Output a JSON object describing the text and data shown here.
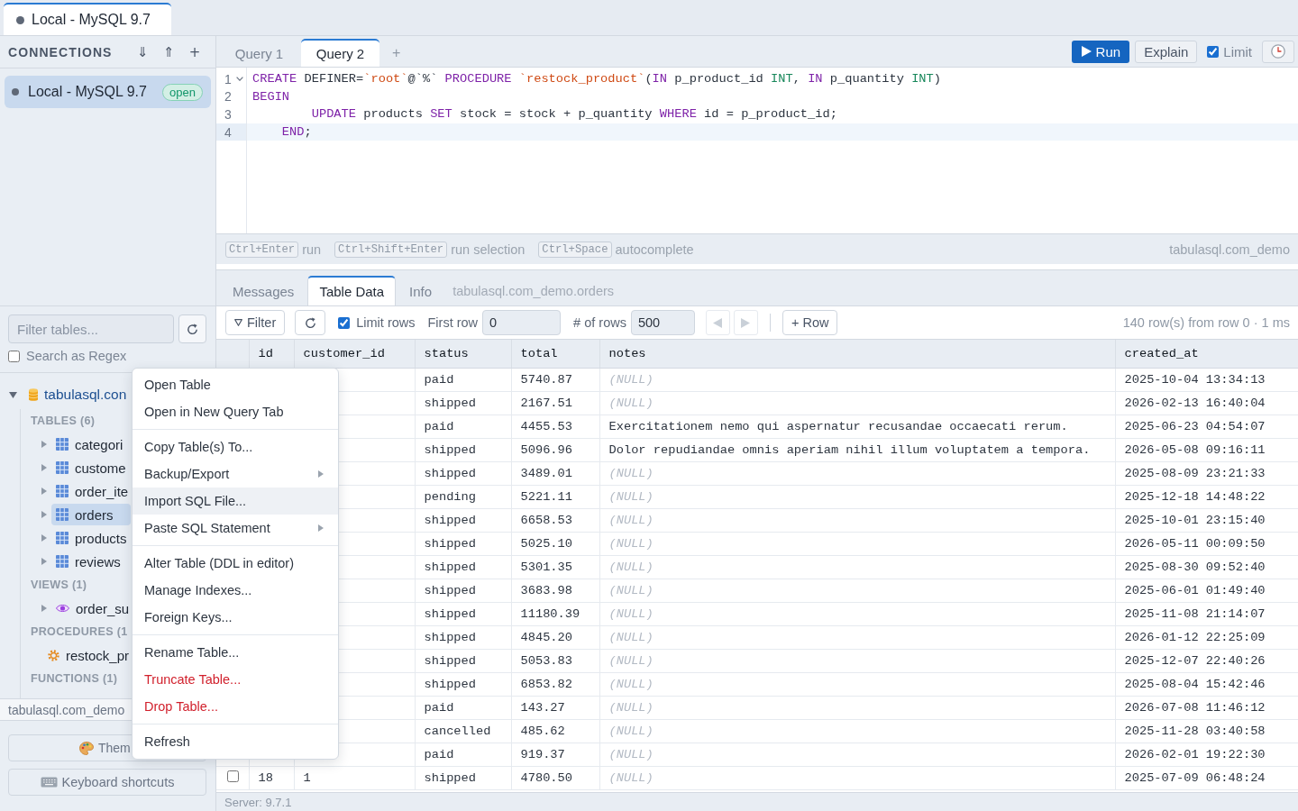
{
  "window_tabs": [
    {
      "label": "Local - MySQL 9.7",
      "selected": true
    }
  ],
  "sidebar": {
    "title": "CONNECTIONS",
    "actions": [
      "⇓",
      "⇑",
      "+"
    ],
    "connections": [
      {
        "name": "Local - MySQL 9.7",
        "badge": "open",
        "selected": true
      }
    ],
    "filter": {
      "placeholder": "Filter tables..."
    },
    "regex": {
      "label": "Search as Regex",
      "checked": false
    },
    "tree": {
      "name": "tabulasql.con",
      "expanded": true,
      "children": [
        {
          "kind": "section",
          "label": "TABLES (6)",
          "children": [
            {
              "kind": "table",
              "name": "categori",
              "expanded": false,
              "selected": false
            },
            {
              "kind": "table",
              "name": "custome",
              "expanded": false,
              "selected": false
            },
            {
              "kind": "table",
              "name": "order_ite",
              "expanded": false,
              "selected": false
            },
            {
              "kind": "table",
              "name": "orders",
              "expanded": false,
              "selected": true
            },
            {
              "kind": "table",
              "name": "products",
              "expanded": false,
              "selected": false
            },
            {
              "kind": "table",
              "name": "reviews",
              "expanded": false,
              "selected": false
            }
          ]
        },
        {
          "kind": "section",
          "label": "VIEWS (1)",
          "children": [
            {
              "kind": "view",
              "name": "order_su",
              "expanded": false,
              "selected": false
            }
          ]
        },
        {
          "kind": "section",
          "label": "PROCEDURES (1",
          "children": [
            {
              "kind": "procedure",
              "name": "restock_pr",
              "selected": false
            }
          ]
        },
        {
          "kind": "section",
          "label": "FUNCTIONS (1)"
        }
      ]
    },
    "database": "tabulasql.com_demo",
    "buttons": [
      {
        "kind": "theme",
        "label": "Them"
      },
      {
        "kind": "shortcuts",
        "label": "Keyboard shortcuts"
      }
    ]
  },
  "editor": {
    "tabs": [
      {
        "label": "Query 1",
        "selected": false
      },
      {
        "label": "Query 2",
        "selected": true
      }
    ],
    "new_tab": "+",
    "run": "Run",
    "explain": "Explain",
    "limit": {
      "label": "Limit",
      "checked": true
    },
    "lines": [
      {
        "number": "1",
        "foldable": true,
        "active": false,
        "tokens": [
          {
            "text": "CREATE",
            "kind": "keyword"
          },
          {
            "text": " DEFINER=",
            "kind": "plain"
          },
          {
            "text": "`root`",
            "kind": "string"
          },
          {
            "text": "@`%` ",
            "kind": "plain"
          },
          {
            "text": "PROCEDURE ",
            "kind": "keyword"
          },
          {
            "text": "`restock_product`",
            "kind": "string"
          },
          {
            "text": "(",
            "kind": "plain"
          },
          {
            "text": "IN",
            "kind": "keyword"
          },
          {
            "text": " p_product_id ",
            "kind": "plain"
          },
          {
            "text": "INT",
            "kind": "type"
          },
          {
            "text": ", ",
            "kind": "plain"
          },
          {
            "text": "IN",
            "kind": "keyword"
          },
          {
            "text": " p_quantity ",
            "kind": "plain"
          },
          {
            "text": "INT",
            "kind": "type"
          },
          {
            "text": ")",
            "kind": "plain"
          }
        ]
      },
      {
        "number": "2",
        "foldable": false,
        "active": false,
        "tokens": [
          {
            "text": "BEGIN",
            "kind": "keyword"
          }
        ]
      },
      {
        "number": "3",
        "foldable": false,
        "active": false,
        "tokens": [
          {
            "text": "        UPDATE",
            "kind": "keyword"
          },
          {
            "text": " products ",
            "kind": "plain"
          },
          {
            "text": "SET",
            "kind": "keyword"
          },
          {
            "text": " stock = stock + p_quantity ",
            "kind": "plain"
          },
          {
            "text": "WHERE",
            "kind": "keyword"
          },
          {
            "text": " id = p_product_id;",
            "kind": "plain"
          }
        ]
      },
      {
        "number": "4",
        "foldable": false,
        "active": true,
        "tokens": [
          {
            "text": "    END",
            "kind": "keyword"
          },
          {
            "text": ";",
            "kind": "plain"
          }
        ]
      }
    ],
    "hints": [
      {
        "keys": "Ctrl+Enter",
        "label": "run"
      },
      {
        "keys": "Ctrl+Shift+Enter",
        "label": "run selection"
      },
      {
        "keys": "Ctrl+Space",
        "label": "autocomplete"
      }
    ],
    "database": "tabulasql.com_demo"
  },
  "results": {
    "tabs": [
      {
        "label": "Messages",
        "selected": false
      },
      {
        "label": "Table Data",
        "selected": true
      },
      {
        "label": "Info",
        "selected": false
      }
    ],
    "source": "tabulasql.com_demo.orders",
    "toolbar": {
      "filter": "Filter",
      "limit_rows": {
        "label": "Limit rows",
        "checked": true
      },
      "first_row": {
        "label": "First row",
        "value": "0"
      },
      "row_count": {
        "label": "# of rows",
        "value": "500"
      },
      "pager": [
        {
          "kind": "previous",
          "disabled": true
        },
        {
          "kind": "next",
          "disabled": true
        }
      ],
      "add_row": "+ Row",
      "summary": "140 row(s) from row 0 · 1 ms"
    },
    "columns": [
      "id",
      "customer_id",
      "status",
      "total",
      "notes",
      "created_at"
    ],
    "rows": [
      {
        "cells": [
          "paid",
          "5740.87",
          {
            "text": "(NULL)",
            "null": true
          },
          "2025-10-04 13:34:13"
        ]
      },
      {
        "cells": [
          "shipped",
          "2167.51",
          {
            "text": "(NULL)",
            "null": true
          },
          "2026-02-13 16:40:04"
        ]
      },
      {
        "cells": [
          "paid",
          "4455.53",
          {
            "text": "Exercitationem nemo qui aspernatur recusandae occaecati rerum.",
            "null": false
          },
          "2025-06-23 04:54:07"
        ]
      },
      {
        "cells": [
          "shipped",
          "5096.96",
          {
            "text": "Dolor repudiandae omnis aperiam nihil illum voluptatem a tempora.",
            "null": false
          },
          "2026-05-08 09:16:11"
        ]
      },
      {
        "cells": [
          "shipped",
          "3489.01",
          {
            "text": "(NULL)",
            "null": true
          },
          "2025-08-09 23:21:33"
        ]
      },
      {
        "cells": [
          "pending",
          "5221.11",
          {
            "text": "(NULL)",
            "null": true
          },
          "2025-12-18 14:48:22"
        ]
      },
      {
        "cells": [
          "shipped",
          "6658.53",
          {
            "text": "(NULL)",
            "null": true
          },
          "2025-10-01 23:15:40"
        ]
      },
      {
        "cells": [
          "shipped",
          "5025.10",
          {
            "text": "(NULL)",
            "null": true
          },
          "2026-05-11 00:09:50"
        ]
      },
      {
        "cells": [
          "shipped",
          "5301.35",
          {
            "text": "(NULL)",
            "null": true
          },
          "2025-08-30 09:52:40"
        ]
      },
      {
        "cells": [
          "shipped",
          "3683.98",
          {
            "text": "(NULL)",
            "null": true
          },
          "2025-06-01 01:49:40"
        ]
      },
      {
        "cells": [
          "shipped",
          "11180.39",
          {
            "text": "(NULL)",
            "null": true
          },
          "2025-11-08 21:14:07"
        ]
      },
      {
        "cells": [
          "shipped",
          "4845.20",
          {
            "text": "(NULL)",
            "null": true
          },
          "2026-01-12 22:25:09"
        ]
      },
      {
        "cells": [
          "shipped",
          "5053.83",
          {
            "text": "(NULL)",
            "null": true
          },
          "2025-12-07 22:40:26"
        ]
      },
      {
        "cells": [
          "shipped",
          "6853.82",
          {
            "text": "(NULL)",
            "null": true
          },
          "2025-08-04 15:42:46"
        ]
      },
      {
        "cells": [
          "paid",
          "143.27",
          {
            "text": "(NULL)",
            "null": true
          },
          "2026-07-08 11:46:12"
        ]
      },
      {
        "cells": [
          "cancelled",
          "485.62",
          {
            "text": "(NULL)",
            "null": true
          },
          "2025-11-28 03:40:58"
        ]
      },
      {
        "cells": [
          "paid",
          "919.37",
          {
            "text": "(NULL)",
            "null": true
          },
          "2026-02-01 19:22:30"
        ]
      },
      {
        "checked": false,
        "cells": [
          "18",
          "1",
          "shipped",
          "4780.50",
          {
            "text": "(NULL)",
            "null": true
          },
          "2025-07-09 06:48:24"
        ]
      }
    ]
  },
  "context_menu": {
    "groups": [
      {
        "items": [
          {
            "label": "Open Table",
            "kind": "normal",
            "submenu": false,
            "highlighted": false
          },
          {
            "label": "Open in New Query Tab",
            "kind": "normal",
            "submenu": false,
            "highlighted": false
          }
        ]
      },
      {
        "items": [
          {
            "label": "Copy Table(s) To...",
            "kind": "normal",
            "submenu": false,
            "highlighted": false
          },
          {
            "label": "Backup/Export",
            "kind": "normal",
            "submenu": true,
            "highlighted": false
          },
          {
            "label": "Import SQL File...",
            "kind": "normal",
            "submenu": false,
            "highlighted": true
          },
          {
            "label": "Paste SQL Statement",
            "kind": "normal",
            "submenu": true,
            "highlighted": false
          }
        ]
      },
      {
        "items": [
          {
            "label": "Alter Table (DDL in editor)",
            "kind": "normal",
            "submenu": false,
            "highlighted": false
          },
          {
            "label": "Manage Indexes...",
            "kind": "normal",
            "submenu": false,
            "highlighted": false
          },
          {
            "label": "Foreign Keys...",
            "kind": "normal",
            "submenu": false,
            "highlighted": false
          }
        ]
      },
      {
        "items": [
          {
            "label": "Rename Table...",
            "kind": "normal",
            "submenu": false,
            "highlighted": false
          },
          {
            "label": "Truncate Table...",
            "kind": "danger",
            "submenu": false,
            "highlighted": false
          },
          {
            "label": "Drop Table...",
            "kind": "danger",
            "submenu": false,
            "highlighted": false
          }
        ]
      },
      {
        "items": [
          {
            "label": "Refresh",
            "kind": "normal",
            "submenu": false,
            "highlighted": false
          }
        ]
      }
    ]
  },
  "status_bar": {
    "text": "Server: 9.7.1"
  }
}
